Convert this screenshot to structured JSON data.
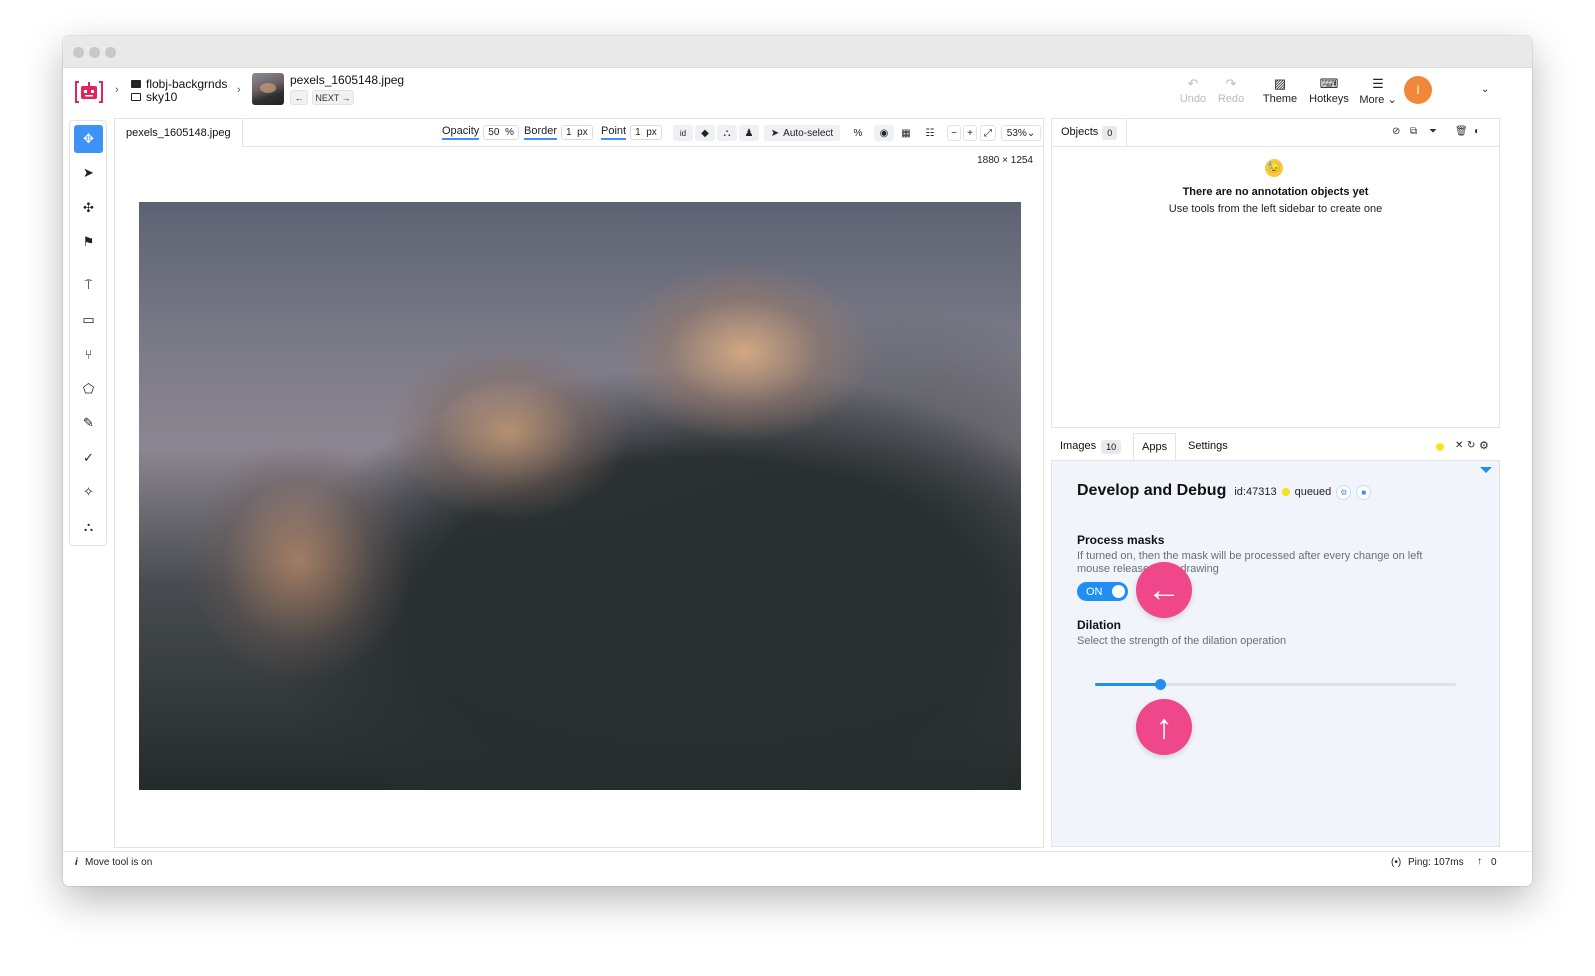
{
  "breadcrumb": {
    "project": "flobj-backgrnds",
    "dataset": "sky10",
    "file": "pexels_1605148.jpeg",
    "prev_label": "←",
    "next_label": "NEXT →"
  },
  "toolbar": {
    "undo": "Undo",
    "redo": "Redo",
    "theme": "Theme",
    "hotkeys": "Hotkeys",
    "more": "More",
    "avatar_initial": "I"
  },
  "left_tools": [
    "move-icon",
    "pointer-icon",
    "drag-icon",
    "flag-icon",
    "keypoint-icon",
    "rectangle-icon",
    "polyline-icon",
    "polygon-icon",
    "brush-icon",
    "eraser-icon",
    "magic-wand-icon",
    "graph-icon"
  ],
  "canvas": {
    "tab": "pexels_1605148.jpeg",
    "opacity_label": "Opacity",
    "opacity_value": "50",
    "opacity_unit": "%",
    "border_label": "Border",
    "border_value": "1",
    "border_unit": "px",
    "point_label": "Point",
    "point_value": "1",
    "point_unit": "px",
    "id_label": "id",
    "autoselect": "Auto-select",
    "zoom": "53%",
    "dimensions": "1880 × 1254"
  },
  "objects_panel": {
    "tab": "Objects",
    "count": "0",
    "emoji": "😓",
    "empty_title": "There are no annotation objects yet",
    "empty_sub": "Use tools from the left sidebar to create one"
  },
  "bottom_tabs": {
    "images": "Images",
    "images_count": "10",
    "apps": "Apps",
    "settings": "Settings"
  },
  "app": {
    "title": "Develop and Debug",
    "id": "id:47313",
    "status": "queued",
    "process_masks_title": "Process masks",
    "process_masks_desc_a": "If turned on, then the mask will be processed after every change on left",
    "process_masks_desc_b": "mouse release",
    "process_masks_desc_c": " while drawing",
    "toggle_label": "ON",
    "dilation_title": "Dilation",
    "dilation_desc": "Select the strength of the dilation operation",
    "dilation_level": 0.18
  },
  "status": {
    "left": "Move tool is on",
    "ping": "Ping: 107ms",
    "uploads": "0"
  },
  "colors": {
    "accent": "#1f8ff4",
    "highlight": "#f0478a",
    "avatar": "#f2873b"
  }
}
